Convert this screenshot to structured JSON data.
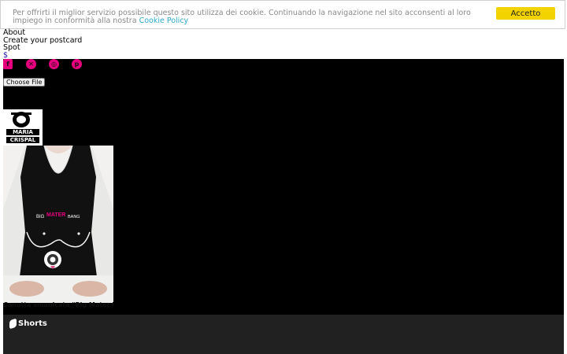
{
  "cookie_banner": {
    "text": "Per offrirti il miglior servizio possibile questo sito utilizza dei cookie. Continuando la navigazione nel sito acconsenti al loro impiego in conformità alla nostra",
    "link_label": "Cookie Policy",
    "accept_label": "Accetto"
  },
  "nav": {
    "items": [
      "About",
      "Create your postcard",
      "Spot"
    ],
    "cart_label": "$"
  },
  "social": {
    "icons": [
      "facebook-icon",
      "x-icon",
      "instagram-icon",
      "pinterest-icon"
    ],
    "color": "#e6007e"
  },
  "upload": {
    "button_label": "Choose File"
  },
  "brand": {
    "line1": "MARIA",
    "line2": "CRISPAL"
  },
  "product": {
    "garment_text_1": "BIG",
    "garment_text_2": "MATER",
    "garment_text_3": "BANG",
    "caption": "Canotta smanicata \"Big Mater Bang\""
  },
  "shorts": {
    "label": "Shorts"
  }
}
